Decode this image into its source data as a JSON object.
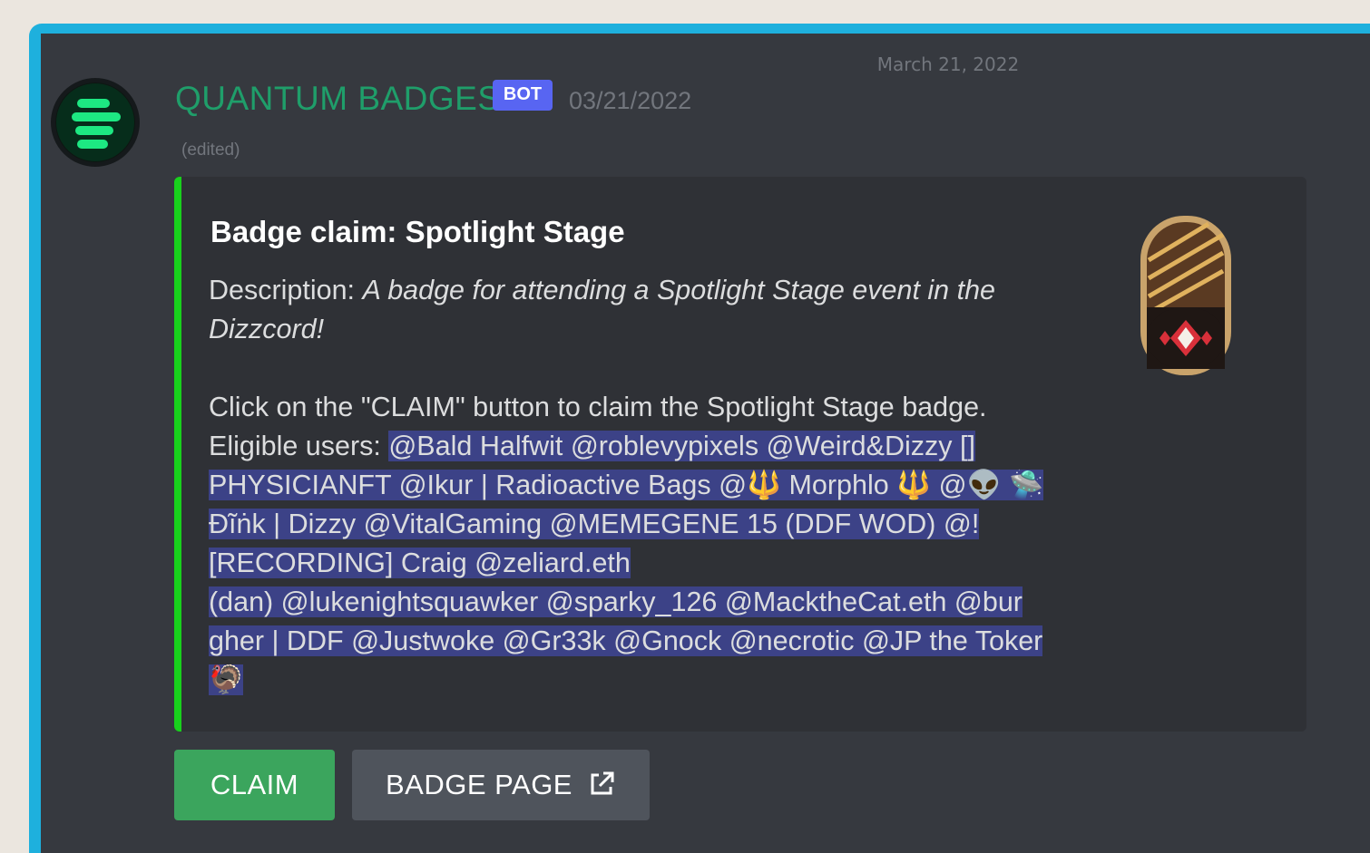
{
  "date_divider": "March 21, 2022",
  "message": {
    "author": "QUANTUM BADGES",
    "bot_tag": "BOT",
    "timestamp": "03/21/2022",
    "edited": "(edited)",
    "avatar_icon": "quantum-badges-logo-icon"
  },
  "embed": {
    "title": "Badge claim: Spotlight Stage",
    "description_label": "Description: ",
    "description_text": "A badge for attending a Spotlight Stage event in the Dizzcord!",
    "instruction": "Click on the \"CLAIM\" button to claim the Spotlight Stage badge.",
    "eligible_label": "Eligible users: ",
    "eligible_line_1": "@Bald Halfwit @roblevypixels @Weird&Dizzy []",
    "eligible_line_2": "PHYSICIANFT @Ikur | Radioactive Bags @🔱 Morphlo 🔱 @👽 🛸",
    "eligible_line_3": "Đĩṅk | Dizzy @VitalGaming @MEMEGENE 15 (DDF WOD) @!",
    "eligible_line_4": "[RECORDING] Craig @zeliard.eth",
    "eligible_line_5": "(dan) @lukenightsquawker @sparky_126 @MacktheCat.eth @bur",
    "eligible_line_6": "gher | DDF @Justwoke @Gr33k @Gnock @necrotic @JP the Toker",
    "eligible_line_7": "🦃",
    "accent_color": "#18d11c",
    "thumbnail_icon": "spotlight-stage-badge-icon"
  },
  "buttons": {
    "claim": "CLAIM",
    "badge_page": "BADGE PAGE",
    "badge_page_icon": "external-link-icon"
  },
  "colors": {
    "claim_button": "#3ba55d",
    "secondary_button": "#4f545c",
    "bot_badge": "#5865f2",
    "author_name": "#1f9e6a",
    "mention_highlight": "#3c4287"
  }
}
